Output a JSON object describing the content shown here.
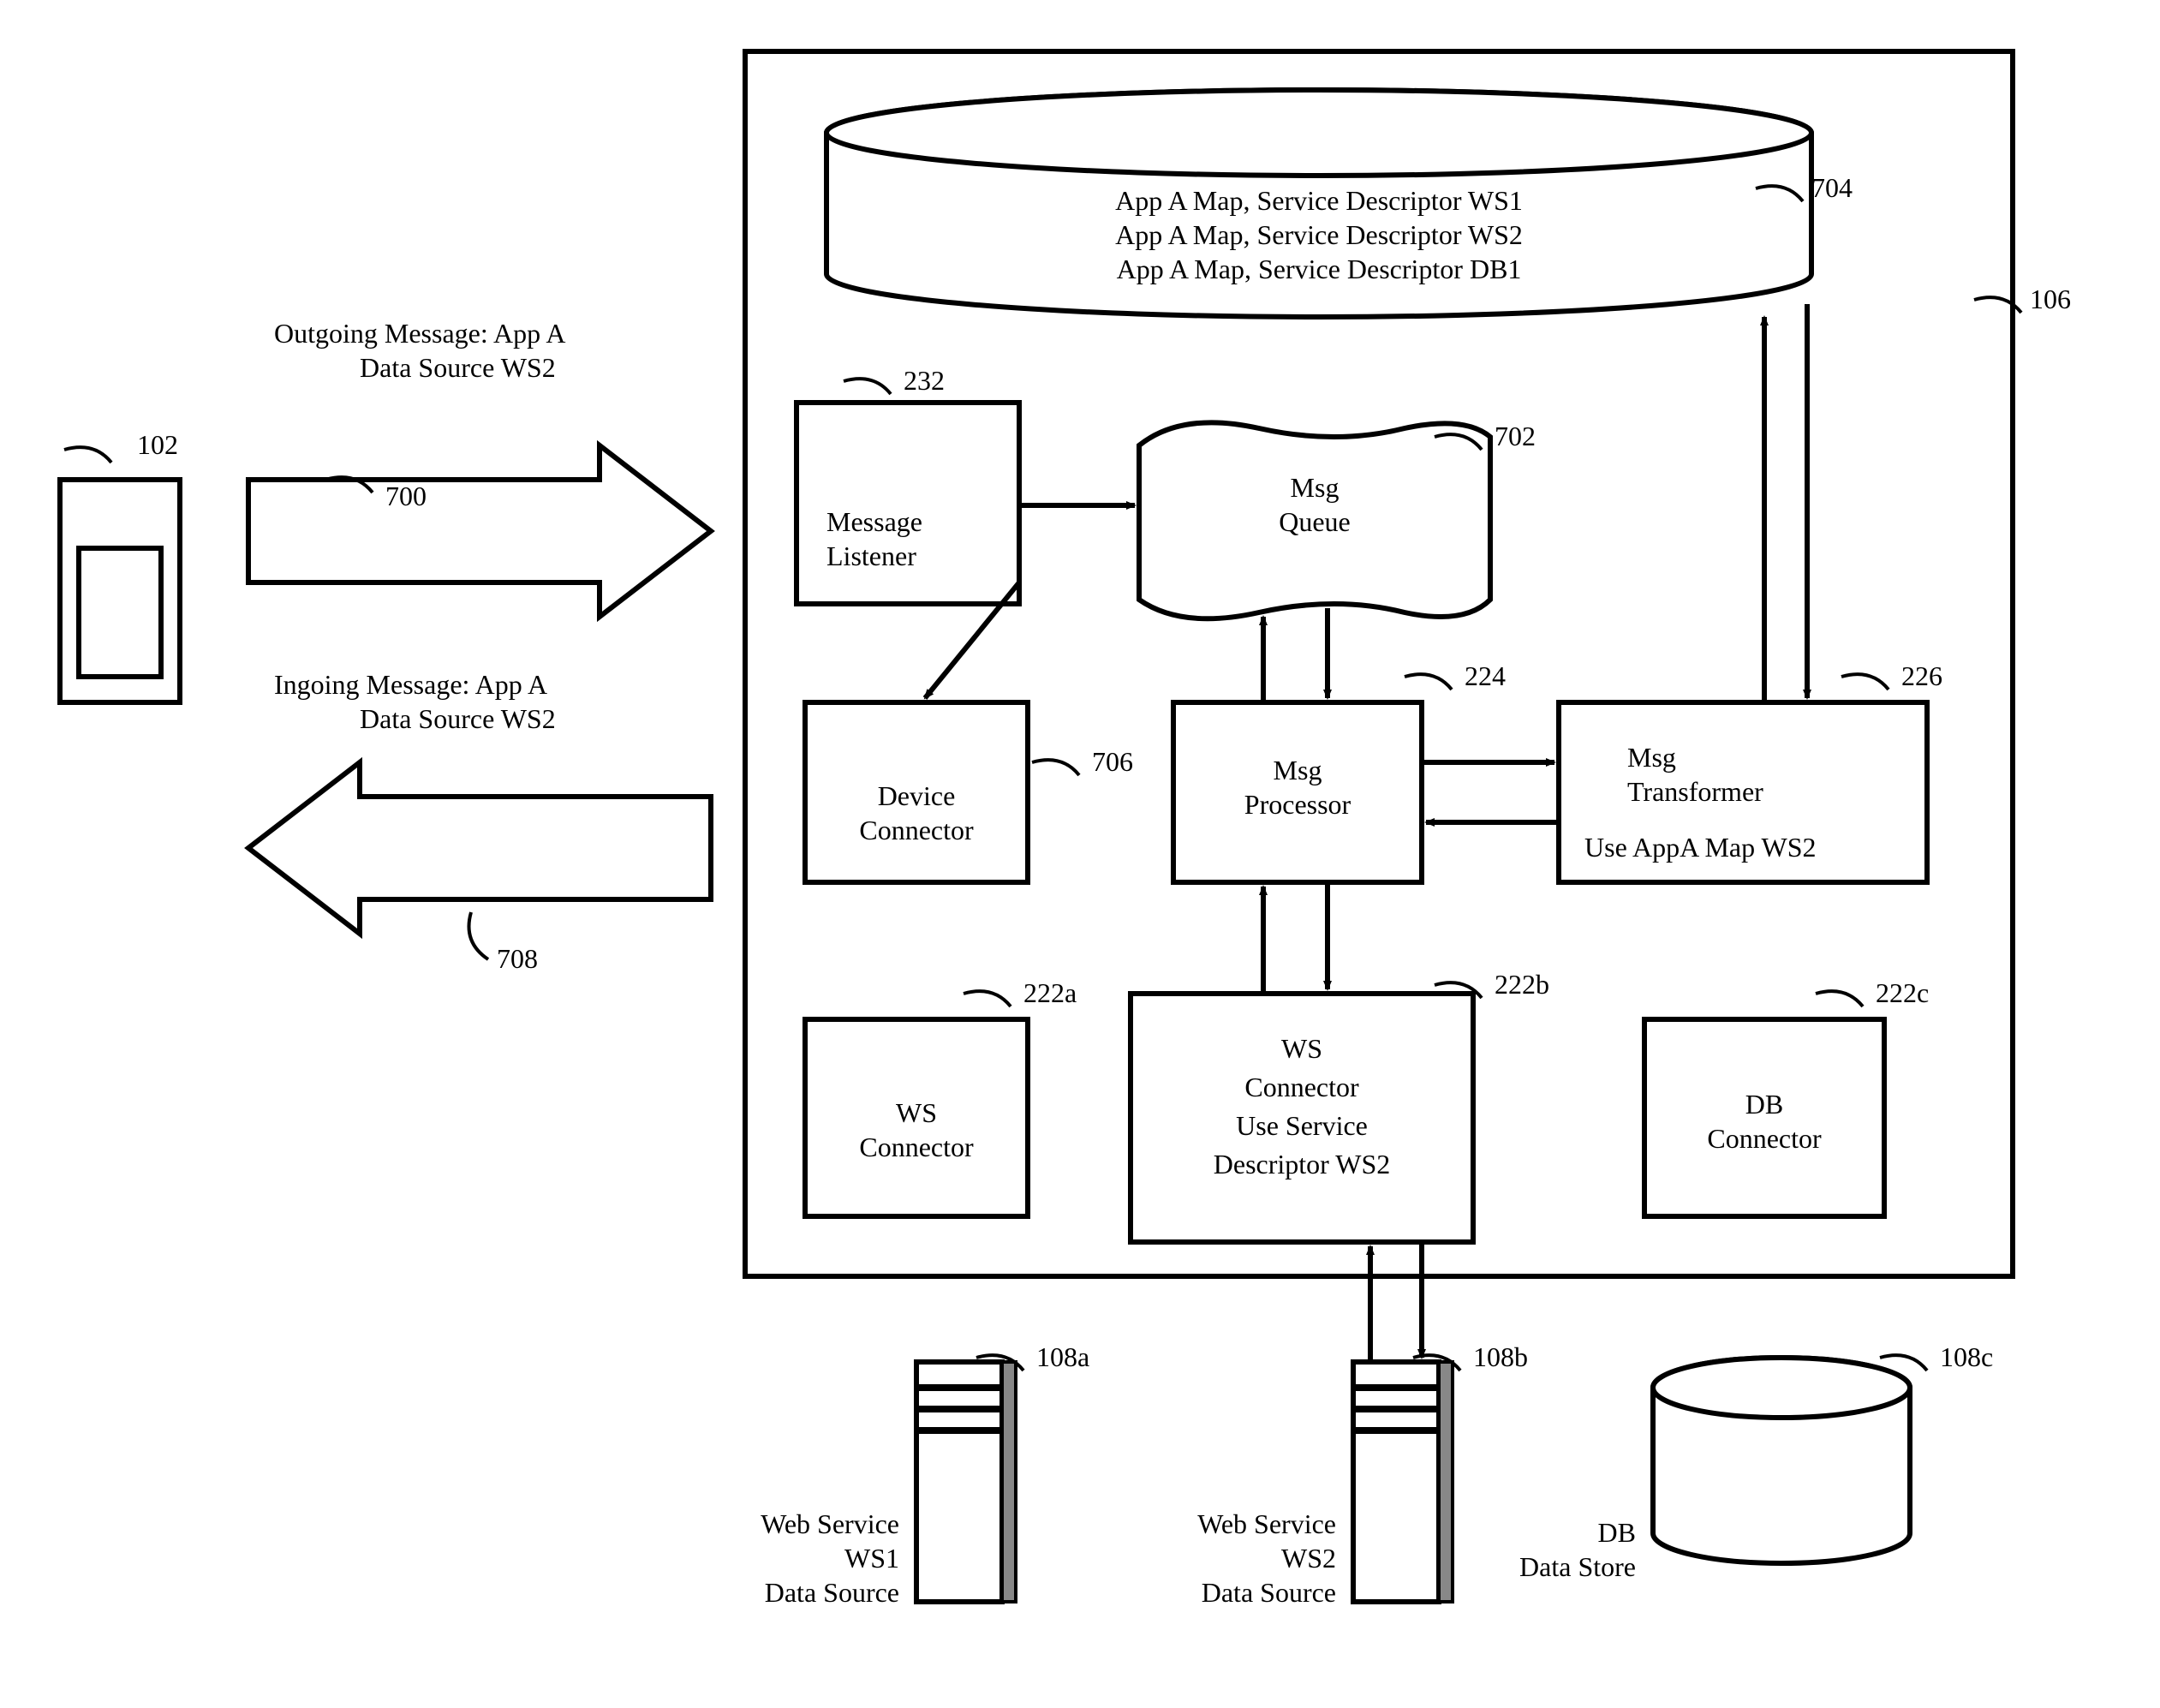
{
  "device_ref": "102",
  "outgoing_arrow_ref": "700",
  "ingoing_arrow_ref": "708",
  "outgoing_msg_line1": "Outgoing Message: App A",
  "outgoing_msg_line2": "Data Source WS2",
  "ingoing_msg_line1": "Ingoing Message: App A",
  "ingoing_msg_line2": "Data Source WS2",
  "main_box_ref": "106",
  "db_cyl_ref": "704",
  "db_cyl_line1": "App A Map, Service Descriptor WS1",
  "db_cyl_line2": "App A Map, Service Descriptor WS2",
  "db_cyl_line3": "App A Map, Service Descriptor DB1",
  "msg_listener_ref": "232",
  "msg_listener_line1": "Message",
  "msg_listener_line2": "Listener",
  "msg_queue_ref": "702",
  "msg_queue_line1": "Msg",
  "msg_queue_line2": "Queue",
  "msg_processor_ref": "224",
  "msg_processor_line1": "Msg",
  "msg_processor_line2": "Processor",
  "msg_transformer_ref": "226",
  "msg_transformer_line1": "Msg",
  "msg_transformer_line2": "Transformer",
  "msg_transformer_line3": "Use AppA Map WS2",
  "device_connector_ref": "706",
  "device_connector_line1": "Device",
  "device_connector_line2": "Connector",
  "ws1_ref": "222a",
  "ws1_line1": "WS",
  "ws1_line2": "Connector",
  "ws2_ref": "222b",
  "ws2_line1": "WS",
  "ws2_line2": "Connector",
  "ws2_line3": "Use Service",
  "ws2_line4": "Descriptor WS2",
  "dbconn_ref": "222c",
  "dbconn_line1": "DB",
  "dbconn_line2": "Connector",
  "svc1_ref": "108a",
  "svc1_l1": "Web Service",
  "svc1_l2": "WS1",
  "svc1_l3": "Data Source",
  "svc2_ref": "108b",
  "svc2_l1": "Web Service",
  "svc2_l2": "WS2",
  "svc2_l3": "Data Source",
  "svc3_ref": "108c",
  "svc3_l1": "DB",
  "svc3_l2": "Data Store"
}
